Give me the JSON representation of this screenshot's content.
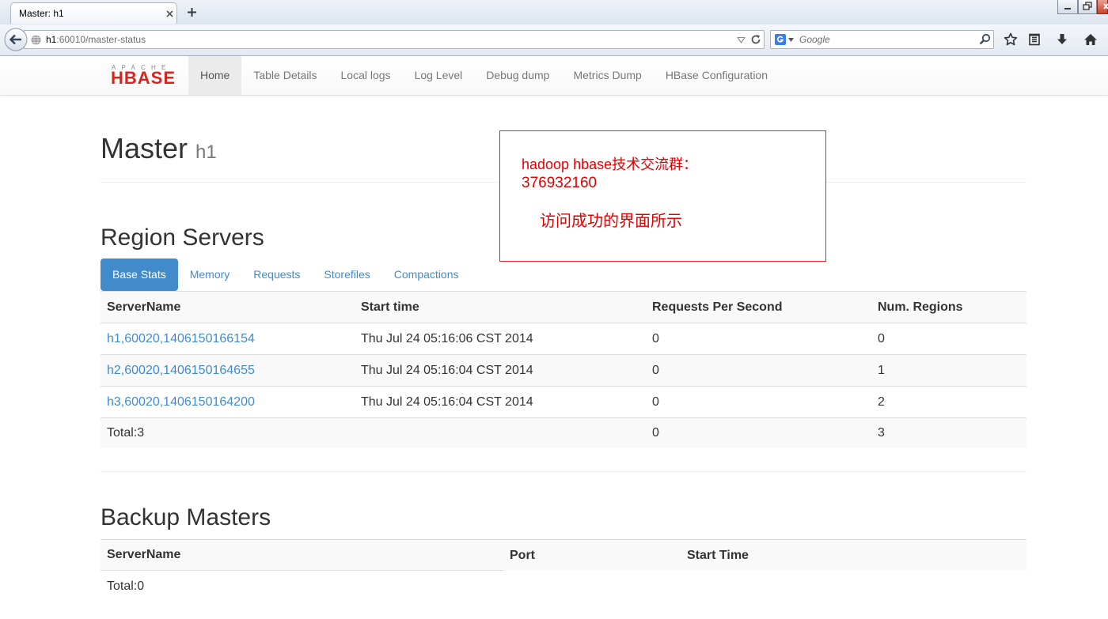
{
  "browser": {
    "tab_title": "Master: h1",
    "url_host": "h1",
    "url_path": ":60010/master-status",
    "search_placeholder": "Google"
  },
  "icons": {
    "tab_close": "close-icon",
    "new_tab": "plus-icon",
    "back": "back-arrow-icon",
    "site_identity": "globe-icon",
    "url_history": "dropdown-triangle-icon",
    "reload": "reload-icon",
    "search_engine": "google-icon",
    "search_engine_menu": "chevron-down-icon",
    "search": "search-icon",
    "bookmark": "star-icon",
    "bookmarks_menu": "bookmarks-list-icon",
    "downloads": "download-icon",
    "home": "home-icon",
    "window_minimize": "minimize-icon",
    "window_restore": "restore-icon",
    "window_close": "window-close-icon"
  },
  "navbar": {
    "logo_top": "APACHE",
    "logo_main": "HBASE",
    "items": [
      {
        "label": "Home",
        "active": true
      },
      {
        "label": "Table Details"
      },
      {
        "label": "Local logs"
      },
      {
        "label": "Log Level"
      },
      {
        "label": "Debug dump"
      },
      {
        "label": "Metrics Dump"
      },
      {
        "label": "HBase Configuration"
      }
    ]
  },
  "master": {
    "title": "Master",
    "host": "h1"
  },
  "annotation": {
    "line1": "hadoop hbase技术交流群：",
    "line2": "376932160",
    "line3": "访问成功的界面所示"
  },
  "region_servers": {
    "heading": "Region Servers",
    "tabs": [
      {
        "label": "Base Stats",
        "active": true
      },
      {
        "label": "Memory"
      },
      {
        "label": "Requests"
      },
      {
        "label": "Storefiles"
      },
      {
        "label": "Compactions"
      }
    ],
    "columns": [
      "ServerName",
      "Start time",
      "Requests Per Second",
      "Num. Regions"
    ],
    "rows": [
      {
        "server_name": "h1,60020,1406150166154",
        "start_time": "Thu Jul 24 05:16:06 CST 2014",
        "requests_per_second": "0",
        "num_regions": "0"
      },
      {
        "server_name": "h2,60020,1406150164655",
        "start_time": "Thu Jul 24 05:16:04 CST 2014",
        "requests_per_second": "0",
        "num_regions": "1"
      },
      {
        "server_name": "h3,60020,1406150164200",
        "start_time": "Thu Jul 24 05:16:04 CST 2014",
        "requests_per_second": "0",
        "num_regions": "2"
      }
    ],
    "total": {
      "label": "Total:3",
      "requests_per_second": "0",
      "num_regions": "3"
    }
  },
  "backup_masters": {
    "heading": "Backup Masters",
    "columns": [
      "ServerName",
      "Port",
      "Start Time"
    ],
    "total": "Total:0"
  },
  "colors": {
    "link": "#428bca",
    "active_pill": "#428bca",
    "annotation": "#e00000",
    "logo": "#d9231d"
  }
}
